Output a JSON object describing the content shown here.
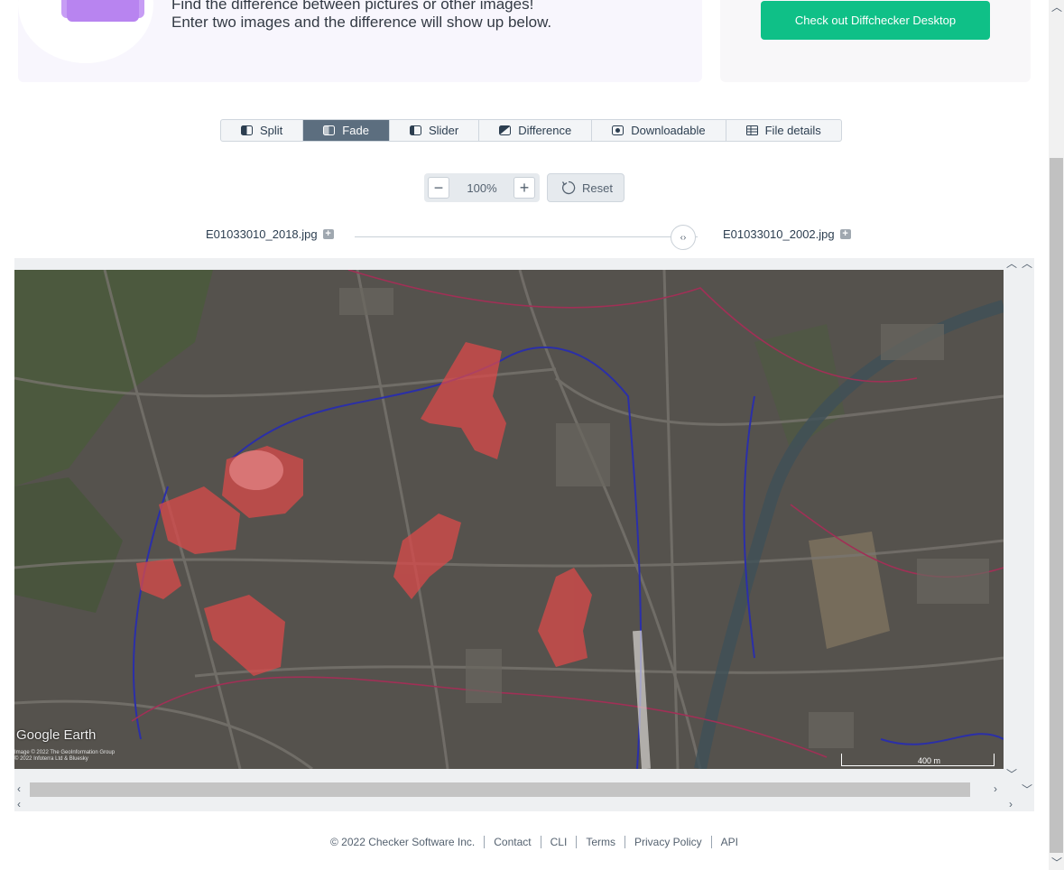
{
  "hero": {
    "line1": "Find the difference between pictures or other images!",
    "line2": "Enter two images and the difference will show up below.",
    "desktop_button": "Check out Diffchecker Desktop",
    "accent": "#0fc087"
  },
  "tabs": [
    {
      "label": "Split",
      "icon": "split-icon",
      "active": false
    },
    {
      "label": "Fade",
      "icon": "fade-icon",
      "active": true
    },
    {
      "label": "Slider",
      "icon": "slider-icon",
      "active": false
    },
    {
      "label": "Difference",
      "icon": "difference-icon",
      "active": false
    },
    {
      "label": "Downloadable",
      "icon": "download-icon",
      "active": false
    },
    {
      "label": "File details",
      "icon": "file-details-icon",
      "active": false
    }
  ],
  "zoom": {
    "value": "100%",
    "reset_label": "Reset"
  },
  "files": {
    "left": "E01033010_2018.jpg",
    "right": "E01033010_2002.jpg"
  },
  "map": {
    "brand": "Google Earth",
    "credit_line1": "Image © 2022 The GeoInformation Group",
    "credit_line2": "© 2022 Infoterra Ltd & Bluesky",
    "scale": "400 m"
  },
  "footer": {
    "copyright": "© 2022 Checker Software Inc.",
    "links": [
      "Contact",
      "CLI",
      "Terms",
      "Privacy Policy",
      "API"
    ]
  }
}
